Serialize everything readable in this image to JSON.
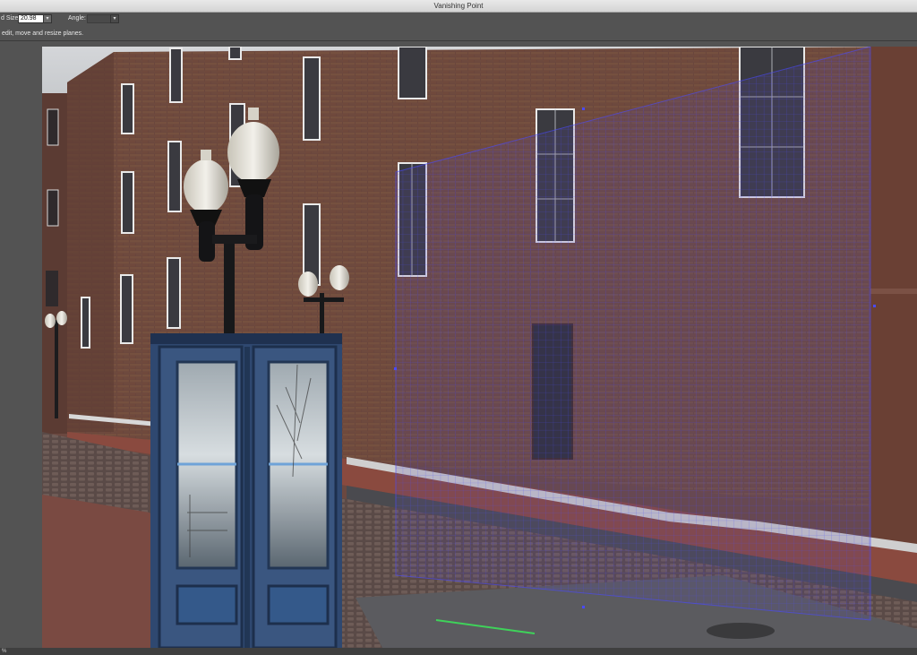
{
  "window": {
    "title": "Vanishing Point"
  },
  "options": {
    "grid_size_label": "d Size:",
    "grid_size_value": "20.98",
    "angle_label": "Angle:",
    "angle_value": ""
  },
  "hint": {
    "text": "edit, move and resize planes."
  },
  "status": {
    "zoom": "%"
  },
  "colors": {
    "grid": "#4a4aff",
    "plane_fill": "#5a4aa8"
  },
  "icons": {
    "dropdown": "chevron-down-icon"
  }
}
